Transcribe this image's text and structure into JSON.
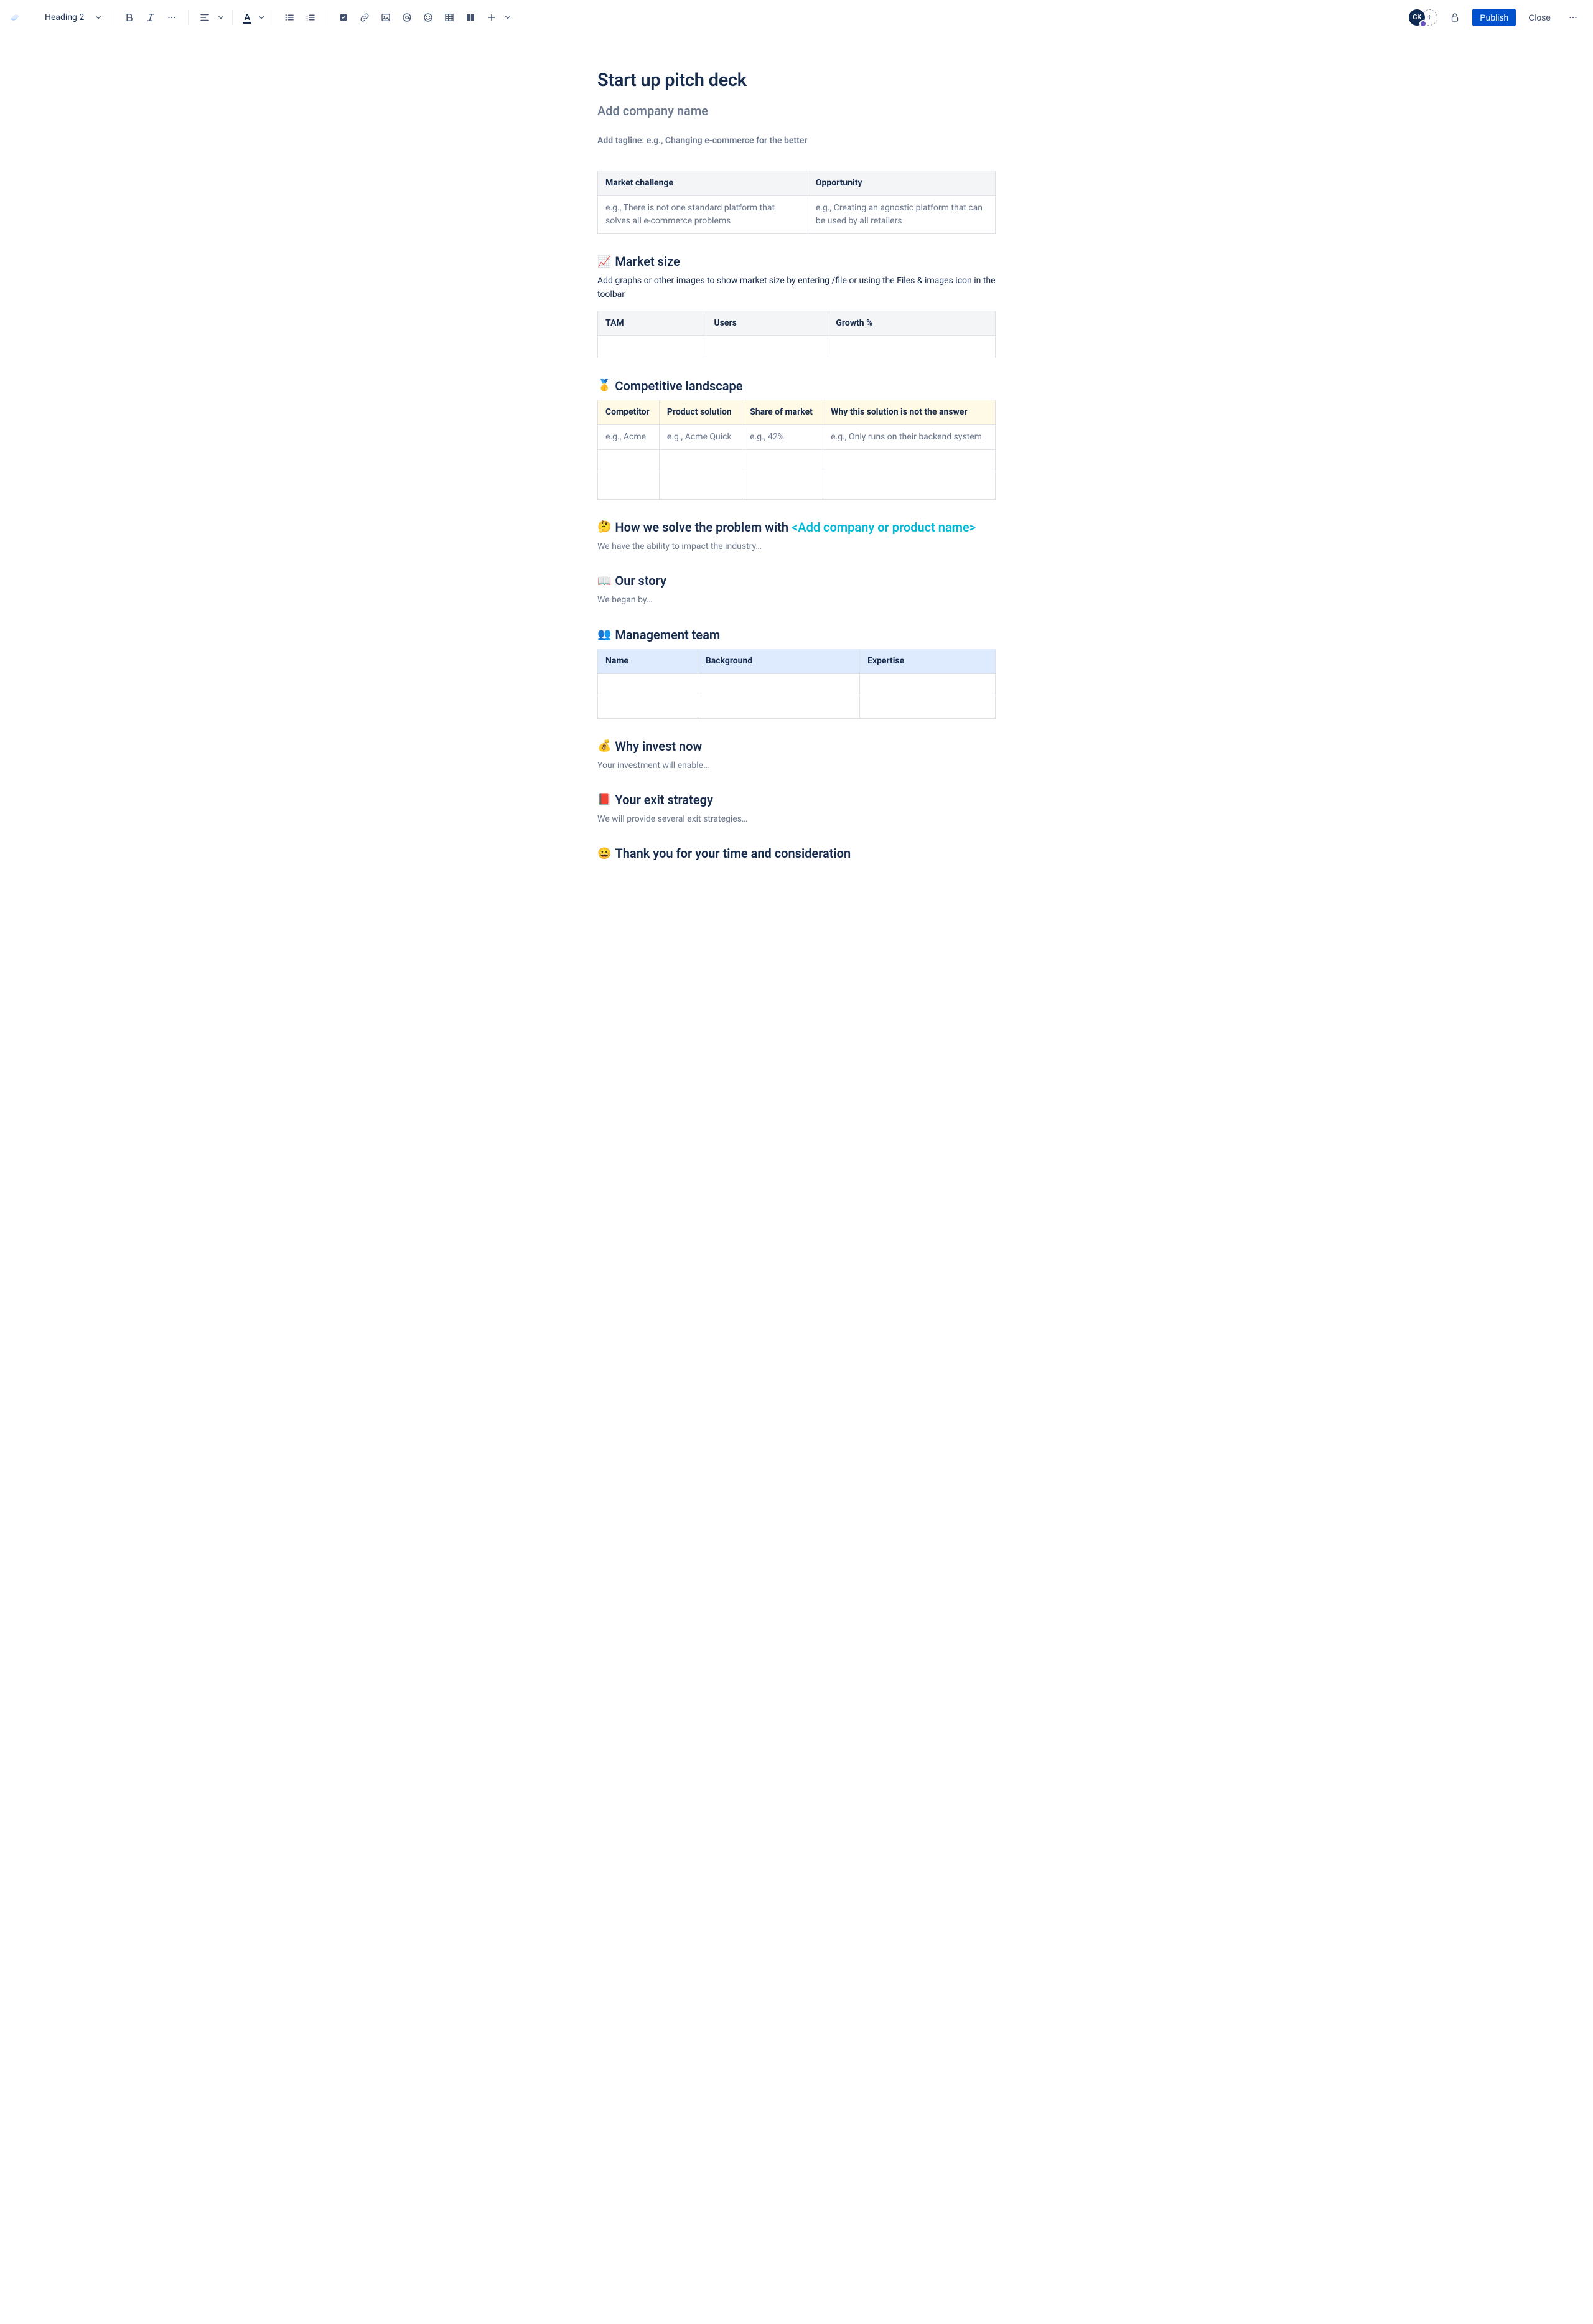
{
  "toolbar": {
    "text_style": "Heading 2",
    "avatar_initials": "CK",
    "publish_label": "Publish",
    "close_label": "Close"
  },
  "page": {
    "title": "Start up pitch deck",
    "company_name_placeholder": "Add company name",
    "tagline": "Add tagline: e.g., Changing e-commerce for the better"
  },
  "market_table": {
    "headers": [
      "Market challenge",
      "Opportunity"
    ],
    "rows": [
      [
        "e.g., There is not one standard platform that solves all e-commerce problems",
        "e.g., Creating an agnostic platform that can be used by all retailers"
      ]
    ]
  },
  "market_size": {
    "emoji": "📈",
    "heading": "Market size",
    "body": "Add graphs or other images to show market size by entering /file or using the Files & images icon in the toolbar",
    "headers": [
      "TAM",
      "Users",
      "Growth %"
    ]
  },
  "competitive": {
    "emoji": "🥇",
    "heading": "Competitive landscape",
    "headers": [
      "Competitor",
      "Product solution",
      "Share of market",
      "Why this solution is not the answer"
    ],
    "rows": [
      [
        "e.g., Acme",
        "e.g., Acme Quick",
        "e.g., 42%",
        "e.g., Only runs on their backend system"
      ]
    ]
  },
  "solve": {
    "emoji": "🤔",
    "heading_a": "How we solve the problem with ",
    "heading_b": "<Add company or product name>",
    "body": "We have the ability to impact the industry…"
  },
  "story": {
    "emoji": "📖",
    "heading": "Our story",
    "body": "We began by…"
  },
  "team": {
    "emoji": "👥",
    "heading": "Management team",
    "headers": [
      "Name",
      "Background",
      "Expertise"
    ]
  },
  "invest": {
    "emoji": "💰",
    "heading": "Why invest now",
    "body": "Your investment will enable…"
  },
  "exit": {
    "emoji": "📕",
    "heading": "Your exit strategy",
    "body": "We will provide several exit strategies…"
  },
  "thanks": {
    "emoji": "😀",
    "heading": "Thank you for your time and consideration"
  }
}
